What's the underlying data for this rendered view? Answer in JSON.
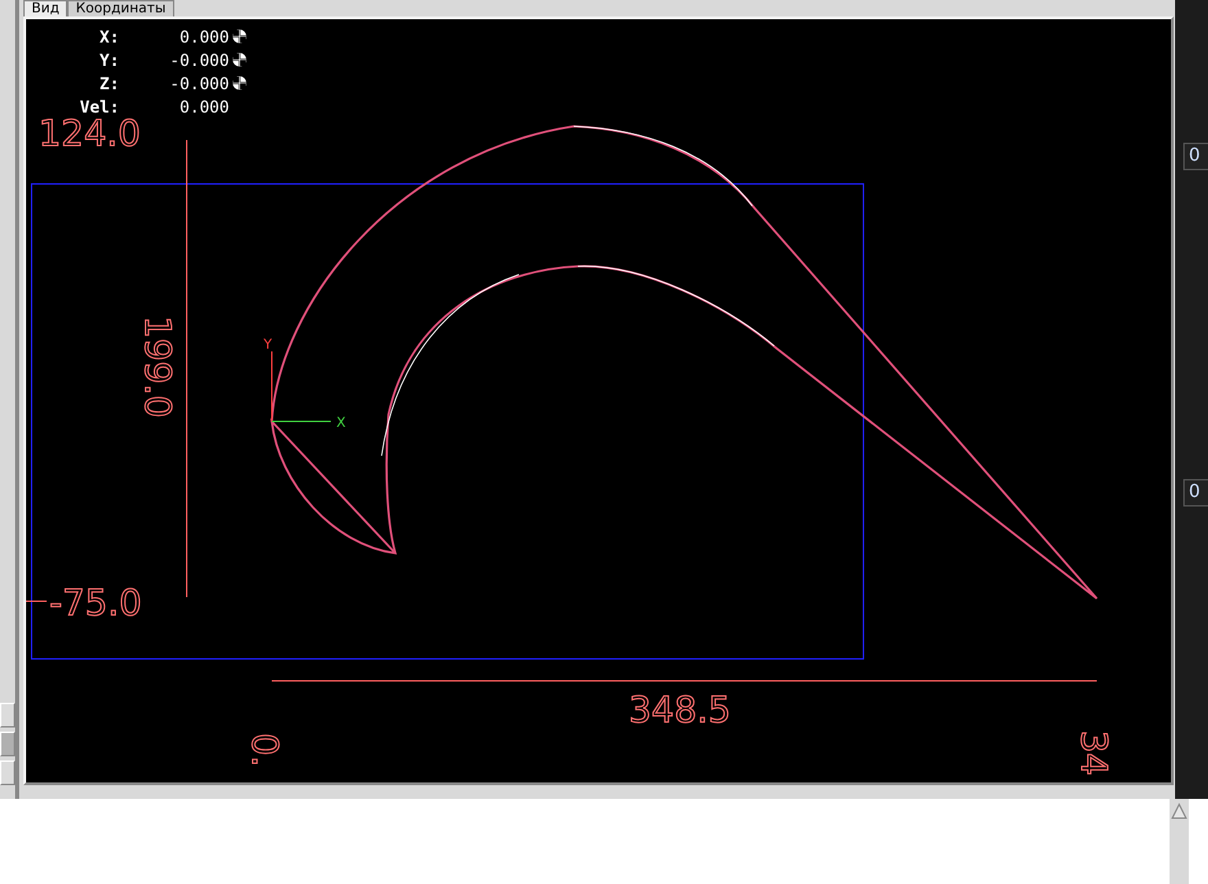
{
  "tabs": [
    {
      "label": "Вид",
      "selected": true
    },
    {
      "label": "Координаты",
      "selected": false
    }
  ],
  "readouts": [
    {
      "axis": "X:",
      "value": "0.000",
      "homed": true
    },
    {
      "axis": "Y:",
      "value": "-0.000",
      "homed": true
    },
    {
      "axis": "Z:",
      "value": "-0.000",
      "homed": true
    },
    {
      "axis": "Vel:",
      "value": "0.000",
      "homed": false
    }
  ],
  "dimension_labels": {
    "y_max": "124.0",
    "y_size": "199.0",
    "y_min": "-75.0",
    "x_size": "348.5",
    "x_min": "0.",
    "x_max": "34"
  },
  "axis_labels": {
    "x": "X",
    "y": "Y"
  },
  "side_fields": [
    "0",
    "0"
  ]
}
